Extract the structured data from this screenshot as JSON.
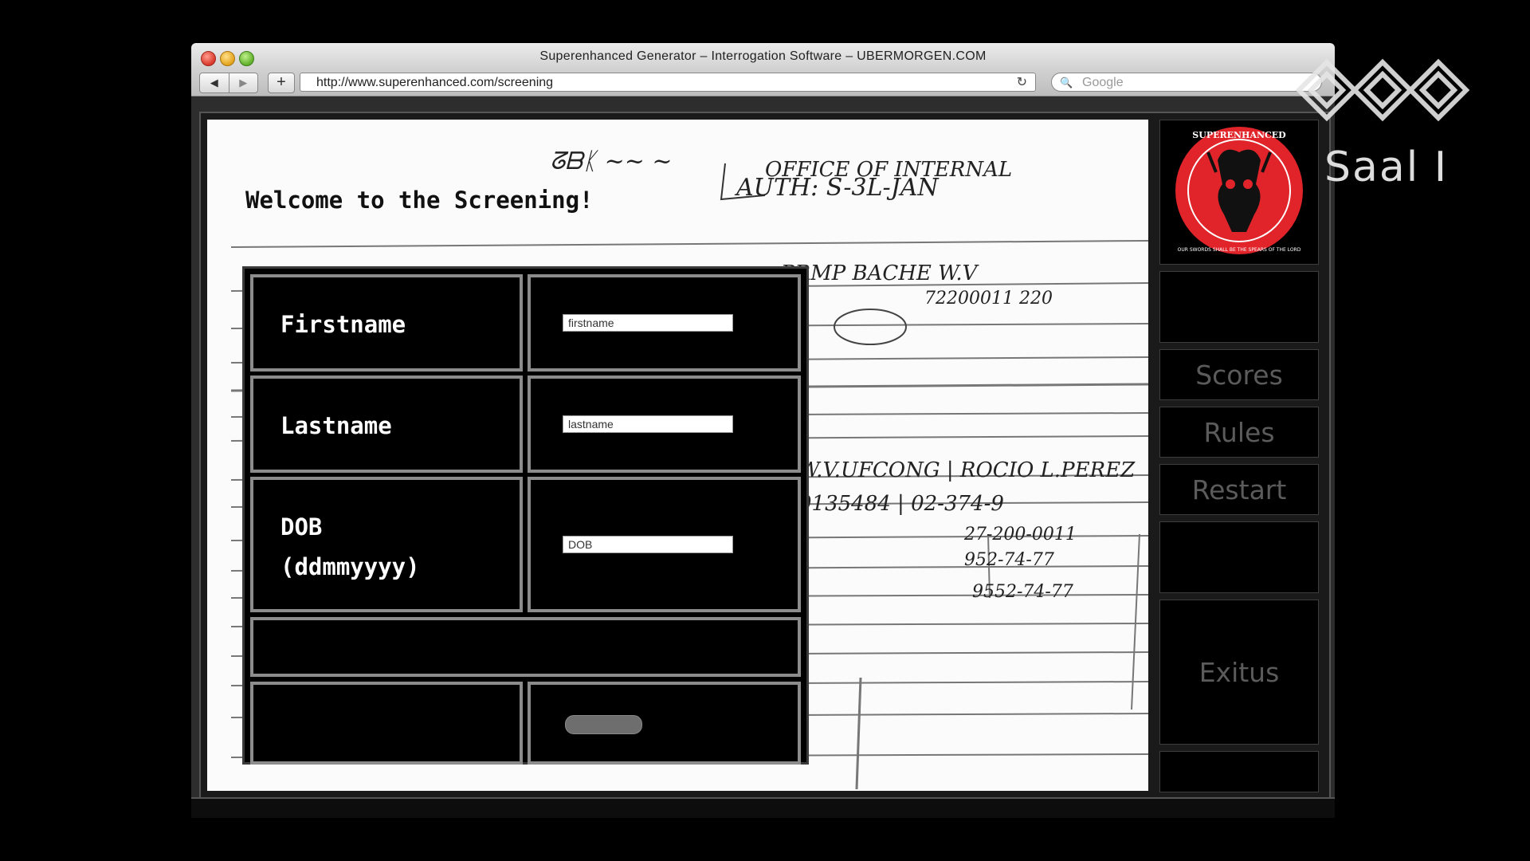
{
  "window": {
    "title": "Superenhanced Generator – Interrogation Software – UBERMORGEN.COM"
  },
  "toolbar": {
    "back_icon": "◀",
    "forward_icon": "▶",
    "new_tab_icon": "+",
    "url": "http://www.superenhanced.com/screening",
    "reload_icon": "↻",
    "search_placeholder": "Google",
    "search_icon": "🔍"
  },
  "page": {
    "welcome": "Welcome to the Screening!"
  },
  "form": {
    "firstname_label": "Firstname",
    "firstname_placeholder": "firstname",
    "lastname_label": "Lastname",
    "lastname_placeholder": "lastname",
    "dob_label_line1": "DOB",
    "dob_label_line2": "(ddmmyyyy)",
    "dob_placeholder": "DOB"
  },
  "logo": {
    "text": "SUPERENHANCED",
    "motto": "OUR SWORDS SHALL BE THE SPEARS OF THE LORD"
  },
  "sidebar": {
    "items": [
      {
        "label": "Scores"
      },
      {
        "label": "Rules"
      },
      {
        "label": "Restart"
      },
      {
        "label": "Exitus"
      }
    ]
  },
  "broadcast": {
    "room_label": "Saal I"
  },
  "colors": {
    "sidebar_text": "#5b5b5b",
    "logo_red": "#e0242a",
    "cell_border": "#8c8c8c"
  }
}
